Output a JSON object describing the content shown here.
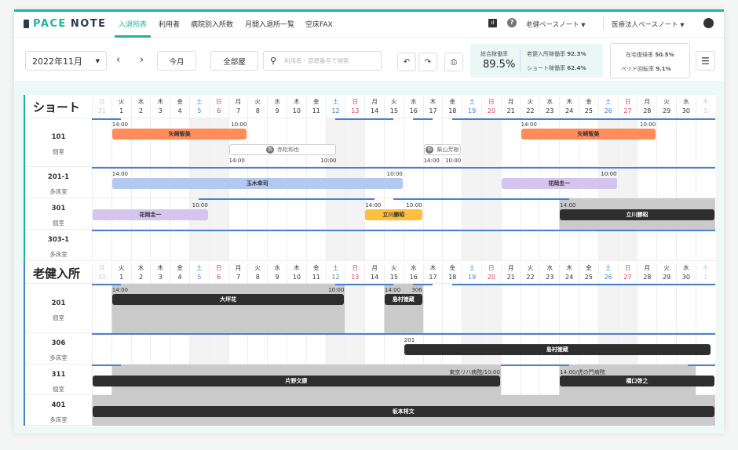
{
  "nav": {
    "logo": "PACENOTE",
    "logo_a": "PACE",
    "logo_b": "NOTE",
    "tabs": [
      {
        "label": "入退所表",
        "active": true
      },
      {
        "label": "利用者"
      },
      {
        "label": "病院別入所数"
      },
      {
        "label": "月間入退所一覧"
      },
      {
        "label": "空床FAX"
      }
    ],
    "facility": "老健ベースノート",
    "corp": "医療法人ベースノート"
  },
  "toolbar": {
    "month": "2022年11月",
    "today": "今月",
    "rooms": "全部屋",
    "search_placeholder": "利用者・部屋番号で検索"
  },
  "stats": {
    "total_label": "総合稼働率",
    "total": "89.5%",
    "roken_label": "老健入所稼働率",
    "roken": "92.3%",
    "short_label": "ショート稼働率",
    "short": "62.4%",
    "home_label": "在宅復帰率",
    "home": "50.5%",
    "bed_label": "ベッド回転率",
    "bed": "9.1%"
  },
  "colors": {
    "accent": "#1fb59a",
    "sat": "#3d7fd6",
    "sun": "#e0405a",
    "orange": "#ff8c5a",
    "blue": "#b3c9ef",
    "purple": "#d4c5f0",
    "yellow": "#ffbe3c",
    "dark": "#2e2e2e"
  },
  "days": [
    [
      "月",
      "31",
      "out"
    ],
    [
      "火",
      "1"
    ],
    [
      "水",
      "2"
    ],
    [
      "木",
      "3"
    ],
    [
      "金",
      "4"
    ],
    [
      "土",
      "5",
      "sat"
    ],
    [
      "日",
      "6",
      "sun"
    ],
    [
      "月",
      "7"
    ],
    [
      "火",
      "8"
    ],
    [
      "水",
      "9"
    ],
    [
      "木",
      "10"
    ],
    [
      "金",
      "11"
    ],
    [
      "土",
      "12",
      "sat"
    ],
    [
      "日",
      "13",
      "sun"
    ],
    [
      "月",
      "14"
    ],
    [
      "火",
      "15"
    ],
    [
      "水",
      "16"
    ],
    [
      "木",
      "17"
    ],
    [
      "金",
      "18"
    ],
    [
      "土",
      "19",
      "sat"
    ],
    [
      "日",
      "20",
      "sun"
    ],
    [
      "月",
      "21"
    ],
    [
      "火",
      "22"
    ],
    [
      "水",
      "23"
    ],
    [
      "木",
      "24"
    ],
    [
      "金",
      "25"
    ],
    [
      "土",
      "26",
      "sat"
    ],
    [
      "日",
      "27",
      "sun"
    ],
    [
      "月",
      "28"
    ],
    [
      "火",
      "29"
    ],
    [
      "水",
      "30"
    ],
    [
      "木",
      "1",
      "out"
    ]
  ],
  "sections": [
    {
      "title": "ショート",
      "accent": "#1fb59a",
      "rooms": [
        {
          "no": "101",
          "type": "個室",
          "lanes": 2,
          "lines": [
            [
              0,
              1.5
            ],
            [
              12.5,
              15.5
            ],
            [
              16.5,
              17.5
            ],
            [
              18.5,
              32
            ]
          ],
          "occ": [],
          "bars": [
            {
              "name": "矢崎智美",
              "s": 1,
              "e": 8,
              "lane": 0,
              "color": "orange",
              "l": "14:00",
              "r": "10:00"
            },
            {
              "name": "矢崎智美",
              "s": 22,
              "e": 29,
              "lane": 0,
              "color": "orange",
              "l": "14:00",
              "r": "10:00"
            },
            {
              "name": "赤松和也",
              "s": 7,
              "e": 12.6,
              "lane": 1,
              "tent": true,
              "tag": "仮",
              "l": "14:00",
              "r": "10:00"
            },
            {
              "name": "柴山芳樹",
              "s": 17,
              "e": 19,
              "lane": 1,
              "tent": true,
              "tag": "仮",
              "l": "14:00",
              "r": "10:00"
            }
          ]
        },
        {
          "no": "201-1",
          "type": "多床室",
          "lines": [
            [
              0,
              32
            ]
          ],
          "occ": [],
          "bars": [
            {
              "name": "玉木幸司",
              "s": 1,
              "e": 16,
              "lane": 0,
              "color": "blue",
              "l": "14:00",
              "r": "10:00"
            },
            {
              "name": "花岡圭一",
              "s": 21,
              "e": 27,
              "lane": 0,
              "color": "purple",
              "r": "10:00"
            }
          ]
        },
        {
          "no": "301",
          "type": "個室",
          "lines": [
            [
              5.5,
              14.5
            ],
            [
              15.5,
              24.5
            ]
          ],
          "occ": [
            [
              24,
              32
            ]
          ],
          "bars": [
            {
              "name": "花岡圭一",
              "s": 0,
              "e": 6,
              "lane": 0,
              "color": "purple",
              "r": "10:00"
            },
            {
              "name": "立川勝昭",
              "s": 14,
              "e": 17,
              "lane": 0,
              "color": "yellow",
              "l": "14:00",
              "r": "10:00"
            },
            {
              "name": "立川勝昭",
              "s": 24,
              "e": 32,
              "lane": 0,
              "color": "dark",
              "l": "14:00"
            }
          ]
        },
        {
          "no": "303-1",
          "type": "多床室",
          "lines": [
            [
              0,
              32
            ]
          ],
          "occ": [],
          "bars": []
        }
      ]
    },
    {
      "title": "老健入所",
      "accent": "#4a7fd4",
      "rooms": [
        {
          "no": "201",
          "type": "個室",
          "lanes": 2,
          "lines": [
            [
              0,
              1.5
            ],
            [
              12.5,
              15.5
            ],
            [
              16.5,
              17.5
            ],
            [
              18.5,
              32
            ]
          ],
          "occ": [
            [
              1,
              13
            ],
            [
              15,
              17
            ]
          ],
          "bars": [
            {
              "name": "大坪花",
              "s": 1,
              "e": 13,
              "lane": 0,
              "color": "dark",
              "l": "14:00",
              "r": "10:00"
            },
            {
              "name": "島村徳蔵",
              "s": 15,
              "e": 17,
              "lane": 0,
              "color": "dark",
              "l": "14:00",
              "r": "306"
            }
          ]
        },
        {
          "no": "306",
          "type": "多床室",
          "lines": [
            [
              0,
              32
            ]
          ],
          "occ": [],
          "bars": [
            {
              "name": "島村徳蔵",
              "s": 16,
              "e": 31.8,
              "lane": 0,
              "color": "dark",
              "l": "201"
            }
          ]
        },
        {
          "no": "311",
          "type": "個室",
          "lines": [
            [
              0,
              1.5
            ],
            [
              21,
              24.5
            ],
            [
              30.6,
              32
            ]
          ],
          "occ": [
            [
              1,
              21
            ],
            [
              24,
              31
            ]
          ],
          "bars": [
            {
              "name": "片野文康",
              "s": 0,
              "e": 21,
              "lane": 0,
              "color": "dark",
              "r": "東京リハ病院/10:00"
            },
            {
              "name": "橋口啓之",
              "s": 24,
              "e": 32,
              "lane": 0,
              "color": "dark",
              "l": "14:00/虎の門病院"
            }
          ]
        },
        {
          "no": "401",
          "type": "多床室",
          "lines": [],
          "occ": [
            [
              0,
              32
            ]
          ],
          "bars": [
            {
              "name": "坂本将文",
              "s": 0,
              "e": 32,
              "lane": 0,
              "color": "dark"
            }
          ]
        }
      ]
    }
  ]
}
